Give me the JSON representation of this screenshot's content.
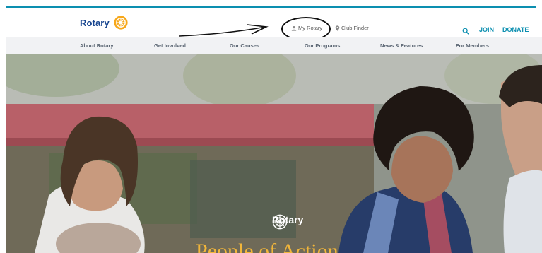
{
  "header": {
    "logo_text": "Rotary",
    "my_rotary": "My Rotary",
    "club_finder": "Club Finder",
    "search_placeholder": "",
    "join": "JOIN",
    "donate": "DONATE"
  },
  "nav": {
    "items": [
      "About Rotary",
      "Get Involved",
      "Our Causes",
      "Our Programs",
      "News & Features",
      "For Members"
    ]
  },
  "hero": {
    "logo_text": "Rotary",
    "headline": "People of Action"
  },
  "colors": {
    "brand_blue": "#17458f",
    "accent_teal": "#0c8fb0",
    "gold": "#f7a81b",
    "headline_gold": "#f2b63a"
  },
  "icons": [
    "rotary-wheel-icon",
    "user-icon",
    "location-pin-icon",
    "search-icon"
  ]
}
